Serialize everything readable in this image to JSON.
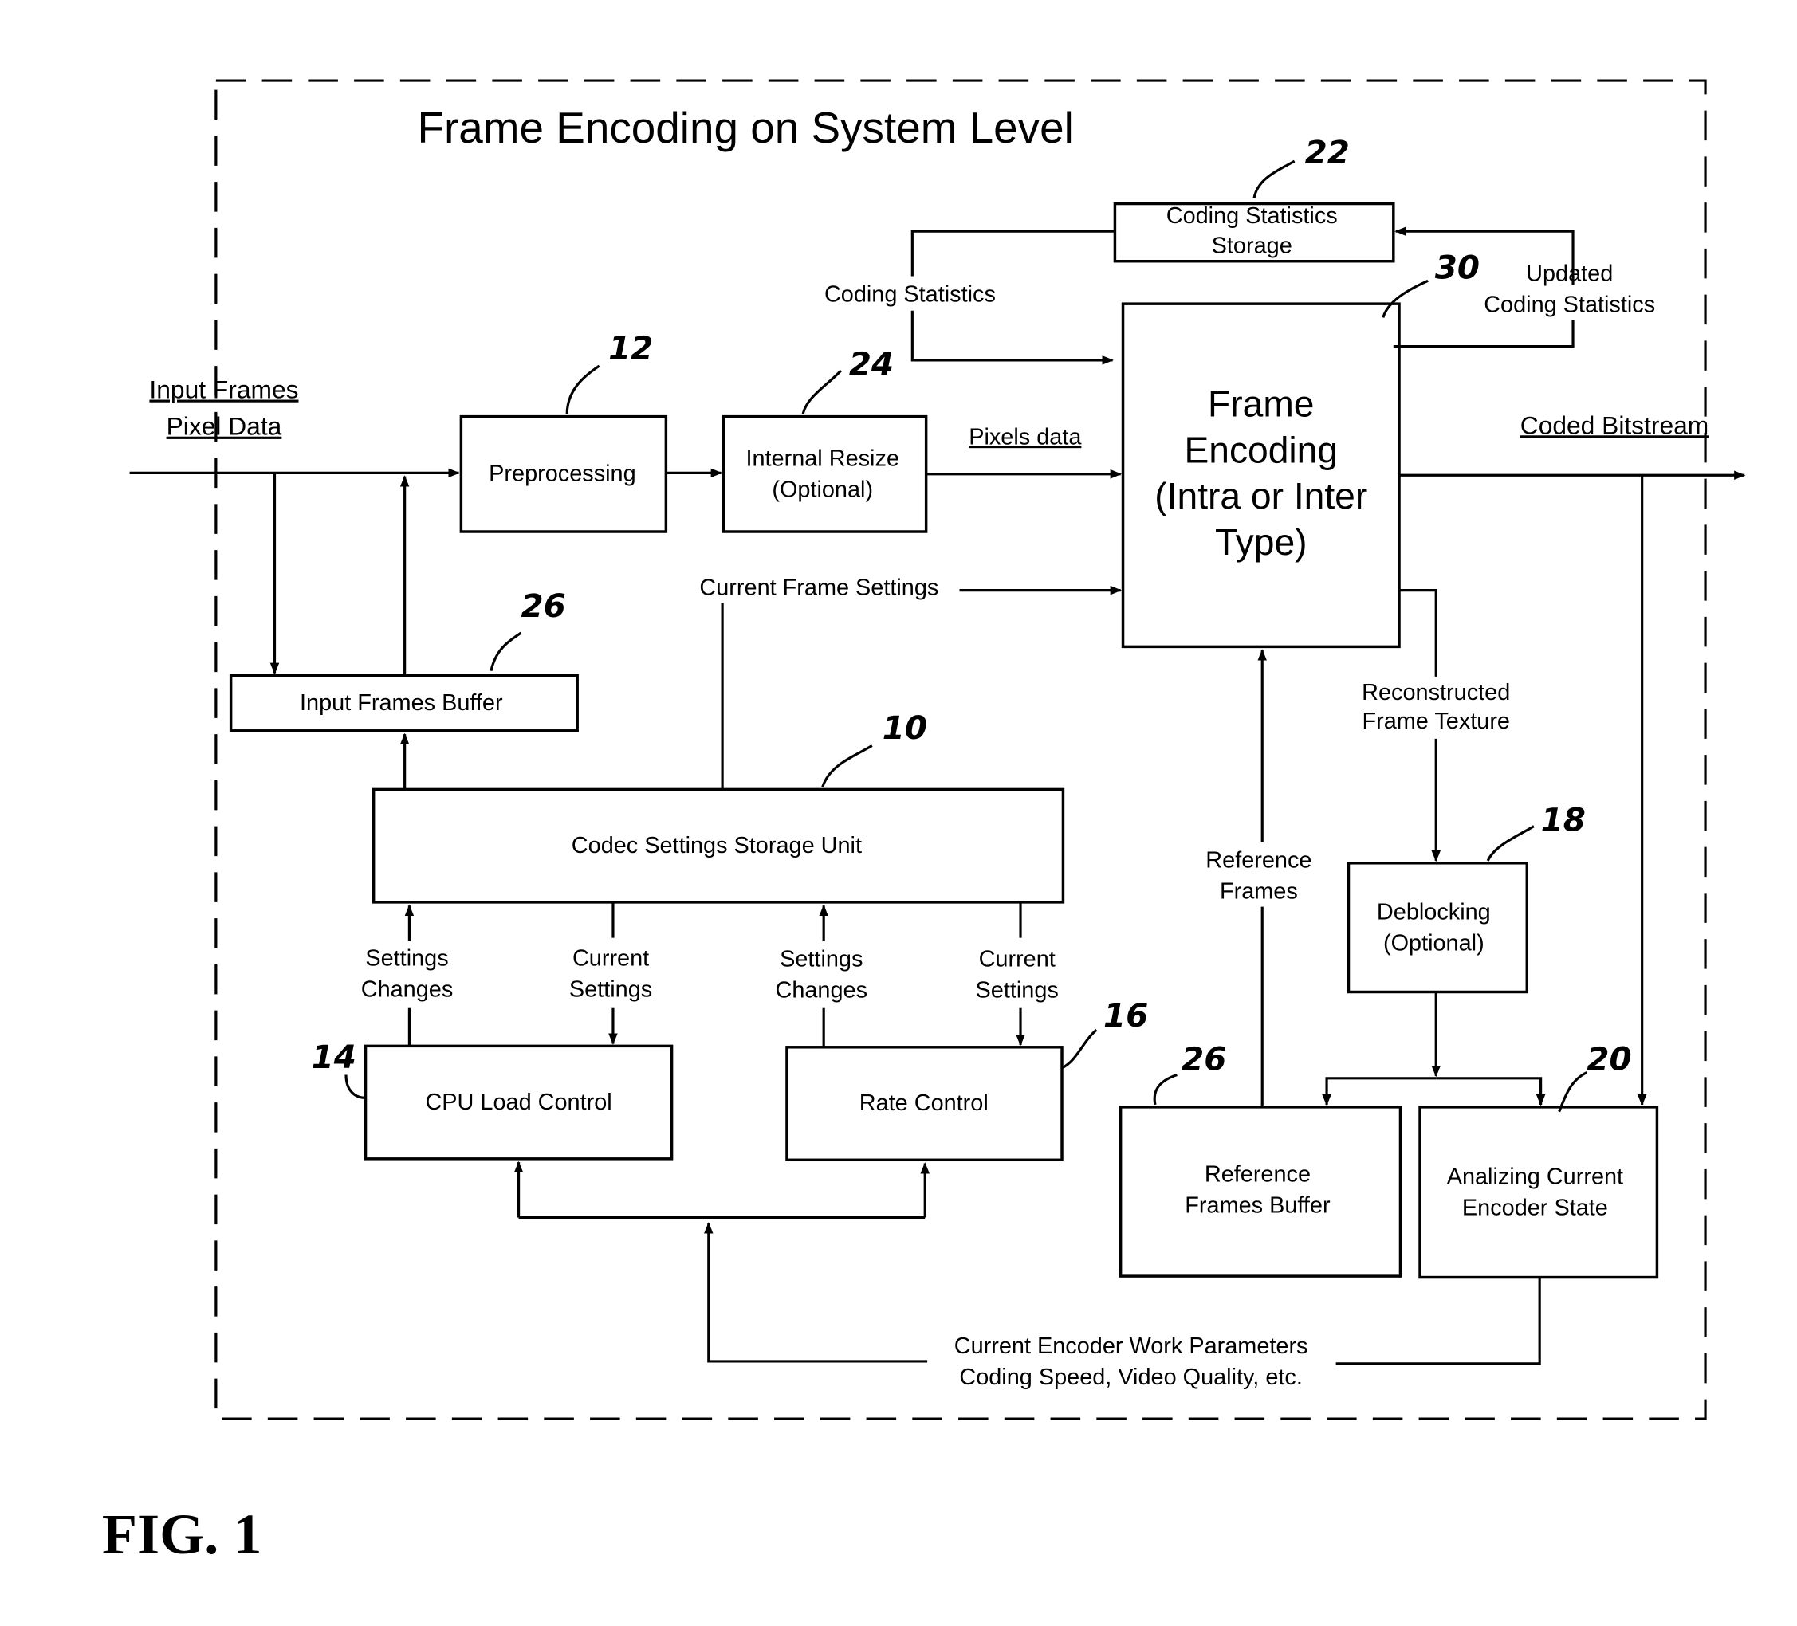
{
  "title": "Frame Encoding on System Level",
  "figure_label": "FIG. 1",
  "inputs": {
    "input_frames": [
      "Input Frames",
      "Pixel Data"
    ],
    "coded_bitstream": "Coded Bitstream",
    "pixels_data": "Pixels data"
  },
  "blocks": {
    "coding_statistics_storage": {
      "lines": [
        "Coding Statistics",
        "Storage"
      ],
      "ref": "22"
    },
    "preprocessing": {
      "lines": [
        "Preprocessing"
      ],
      "ref": "12"
    },
    "internal_resize": {
      "lines": [
        "Internal Resize",
        "(Optional)"
      ],
      "ref": "24"
    },
    "frame_encoding": {
      "lines": [
        "Frame",
        "Encoding",
        "(Intra or Inter",
        "Type)"
      ],
      "ref": "30"
    },
    "input_frames_buffer": {
      "lines": [
        "Input Frames Buffer"
      ],
      "ref": "26"
    },
    "codec_settings_storage": {
      "lines": [
        "Codec Settings Storage Unit"
      ],
      "ref": "10"
    },
    "cpu_load_control": {
      "lines": [
        "CPU Load Control"
      ],
      "ref": "14"
    },
    "rate_control": {
      "lines": [
        "Rate Control"
      ],
      "ref": "16"
    },
    "deblocking": {
      "lines": [
        "Deblocking",
        "(Optional)"
      ],
      "ref": "18"
    },
    "reference_frames_buffer": {
      "lines": [
        "Reference",
        "Frames Buffer"
      ],
      "ref": "26"
    },
    "analyzing_state": {
      "lines": [
        "Analizing Current",
        "Encoder State"
      ],
      "ref": "20"
    }
  },
  "edge_labels": {
    "coding_statistics": "Coding Statistics",
    "updated_coding_statistics": [
      "Updated",
      "Coding Statistics"
    ],
    "current_frame_settings": "Current Frame Settings",
    "reconstructed_frame_texture": [
      "Reconstructed",
      "Frame Texture"
    ],
    "reference_frames": [
      "Reference",
      "Frames"
    ],
    "settings_changes_1": [
      "Settings",
      "Changes"
    ],
    "current_settings_1": [
      "Current",
      "Settings"
    ],
    "settings_changes_2": [
      "Settings",
      "Changes"
    ],
    "current_settings_2": [
      "Current",
      "Settings"
    ],
    "work_parameters": [
      "Current Encoder Work Parameters",
      "Coding Speed, Video Quality, etc."
    ]
  }
}
